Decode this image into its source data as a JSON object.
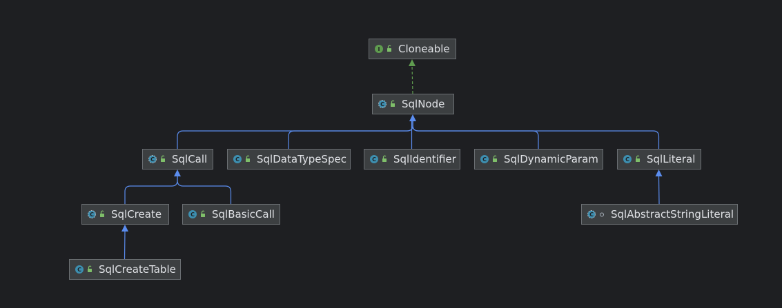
{
  "colors": {
    "background": "#1e1f22",
    "node_fill": "#3c3f41",
    "node_border": "#6b6f73",
    "node_text": "#dfe1e5",
    "edge_extends": "#5b8def",
    "edge_implements": "#5f9c4f",
    "interface_badge": "#5f9c4f",
    "class_badge": "#3d8fb0",
    "abstract_badge": "#3d8fb0",
    "lock_icon": "#7fbf6a"
  },
  "nodes": [
    {
      "id": "cloneable",
      "label": "Cloneable",
      "kind": "interface",
      "badge": "I",
      "visibility": "public"
    },
    {
      "id": "sqlnode",
      "label": "SqlNode",
      "kind": "abstract",
      "badge": "C",
      "visibility": "public"
    },
    {
      "id": "sqlcall",
      "label": "SqlCall",
      "kind": "abstract",
      "badge": "C",
      "visibility": "public"
    },
    {
      "id": "sqldatatypespec",
      "label": "SqlDataTypeSpec",
      "kind": "class",
      "badge": "C",
      "visibility": "public"
    },
    {
      "id": "sqlidentifier",
      "label": "SqlIdentifier",
      "kind": "class",
      "badge": "C",
      "visibility": "public"
    },
    {
      "id": "sqldynamicparam",
      "label": "SqlDynamicParam",
      "kind": "class",
      "badge": "C",
      "visibility": "public"
    },
    {
      "id": "sqlliteral",
      "label": "SqlLiteral",
      "kind": "class",
      "badge": "C",
      "visibility": "public"
    },
    {
      "id": "sqlcreate",
      "label": "SqlCreate",
      "kind": "abstract",
      "badge": "C",
      "visibility": "public"
    },
    {
      "id": "sqlbasiccall",
      "label": "SqlBasicCall",
      "kind": "class",
      "badge": "C",
      "visibility": "public"
    },
    {
      "id": "sqlabstractstringliteral",
      "label": "SqlAbstractStringLiteral",
      "kind": "abstract",
      "badge": "C",
      "visibility": "package"
    },
    {
      "id": "sqlcreatetable",
      "label": "SqlCreateTable",
      "kind": "class",
      "badge": "C",
      "visibility": "public"
    }
  ],
  "edges": [
    {
      "from": "sqlnode",
      "to": "cloneable",
      "type": "implements"
    },
    {
      "from": "sqlcall",
      "to": "sqlnode",
      "type": "extends"
    },
    {
      "from": "sqldatatypespec",
      "to": "sqlnode",
      "type": "extends"
    },
    {
      "from": "sqlidentifier",
      "to": "sqlnode",
      "type": "extends"
    },
    {
      "from": "sqldynamicparam",
      "to": "sqlnode",
      "type": "extends"
    },
    {
      "from": "sqlliteral",
      "to": "sqlnode",
      "type": "extends"
    },
    {
      "from": "sqlcreate",
      "to": "sqlcall",
      "type": "extends"
    },
    {
      "from": "sqlbasiccall",
      "to": "sqlcall",
      "type": "extends"
    },
    {
      "from": "sqlabstractstringliteral",
      "to": "sqlliteral",
      "type": "extends"
    },
    {
      "from": "sqlcreatetable",
      "to": "sqlcreate",
      "type": "extends"
    }
  ]
}
